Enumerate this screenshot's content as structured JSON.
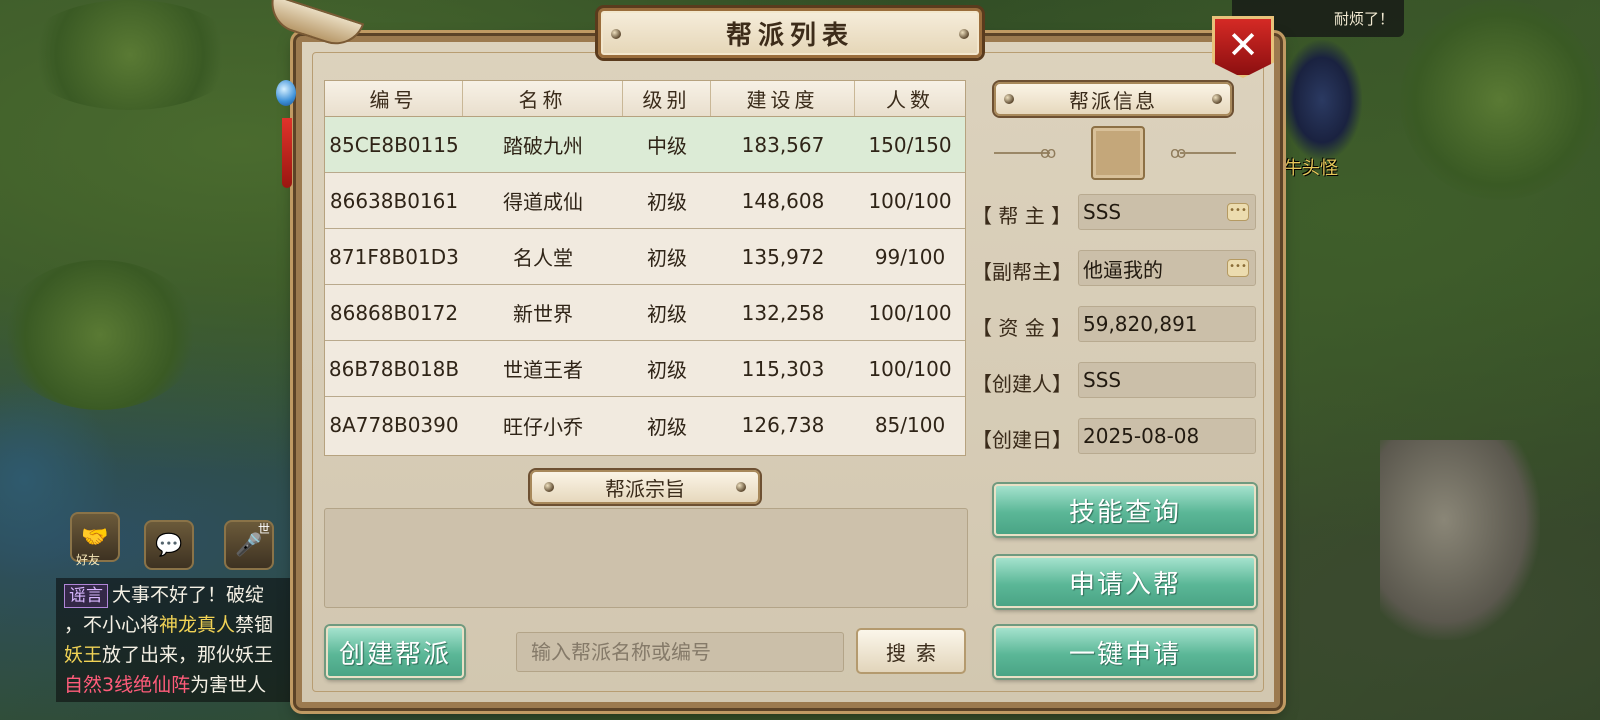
{
  "top_bubble": {
    "text": "耐烦了！"
  },
  "npc": {
    "name": "牛头怪"
  },
  "dialog": {
    "title": "帮派列表",
    "close_icon": "close-x-icon"
  },
  "table": {
    "headers": [
      "编号",
      "名称",
      "级别",
      "建设度",
      "人数"
    ],
    "rows": [
      {
        "id": "85CE8B0115",
        "name": "踏破九州",
        "level": "中级",
        "build": "183,567",
        "members": "150/150"
      },
      {
        "id": "86638B0161",
        "name": "得道成仙",
        "level": "初级",
        "build": "148,608",
        "members": "100/100"
      },
      {
        "id": "871F8B01D3",
        "name": "名人堂",
        "level": "初级",
        "build": "135,972",
        "members": "99/100"
      },
      {
        "id": "86868B0172",
        "name": "新世界",
        "level": "初级",
        "build": "132,258",
        "members": "100/100"
      },
      {
        "id": "86B78B018B",
        "name": "世道王者",
        "level": "初级",
        "build": "115,303",
        "members": "100/100"
      },
      {
        "id": "8A778B0390",
        "name": "旺仔小乔",
        "level": "初级",
        "build": "126,738",
        "members": "85/100"
      }
    ]
  },
  "info": {
    "header": "帮派信息",
    "leader_label": "【 帮  主 】",
    "leader": "SSS",
    "vice_label": "【副帮主】",
    "vice": "他逼我的",
    "funds_label": "【 资  金 】",
    "funds": "59,820,891",
    "creator_label": "【创建人】",
    "creator": "SSS",
    "date_label": "【创建日】",
    "date": "2025-08-08"
  },
  "motto": {
    "header": "帮派宗旨",
    "text": ""
  },
  "actions": {
    "create": "创建帮派",
    "search_placeholder": "输入帮派名称或编号",
    "search": "搜索",
    "skills": "技能查询",
    "apply": "申请入帮",
    "quick_apply": "一键申请"
  },
  "side": {
    "friend_label": "好友",
    "voice_badge": "世"
  },
  "chat": {
    "tag": "谣言",
    "line1": "大事不好了！破绽",
    "line2_a": "，不小心将",
    "line2_b": "神龙真人",
    "line2_c": "禁锢",
    "line3_a": "妖王",
    "line3_b": "放了出来，那伙妖王",
    "line4_a": "自然3线绝仙阵",
    "line4_b": "为害世人"
  }
}
